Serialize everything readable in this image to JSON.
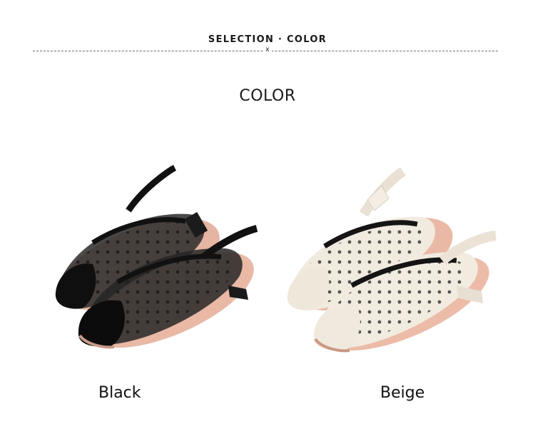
{
  "header": {
    "title": "SELECTION · COLOR",
    "close_mark": "x"
  },
  "section": {
    "title": "COLOR"
  },
  "options": [
    {
      "label": "Black",
      "icon": "black-polka-dot-mesh-slingback-shoes-image"
    },
    {
      "label": "Beige",
      "icon": "beige-polka-dot-mesh-slingback-shoes-image"
    }
  ],
  "colors": {
    "black_shoe": "#161616",
    "beige_shoe": "#efe7da",
    "lining": "#e9b9a6",
    "sole": "#c99884"
  }
}
